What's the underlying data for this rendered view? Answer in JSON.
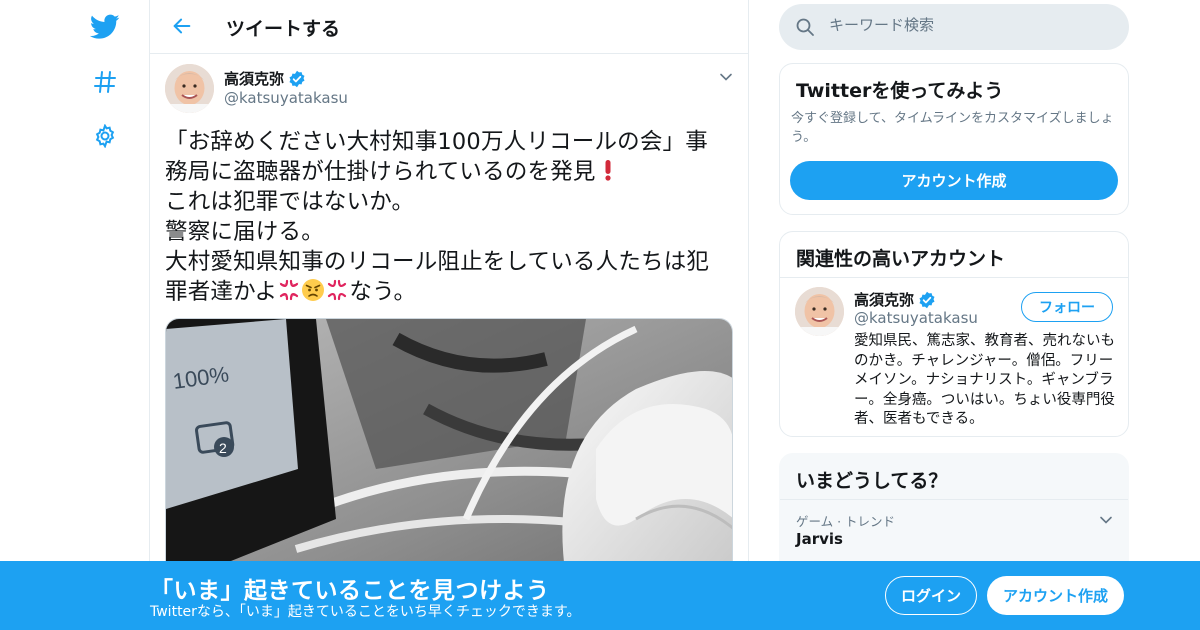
{
  "header": {
    "title": "ツイートする"
  },
  "tweet": {
    "author_name": "高須克弥",
    "author_handle": "@katsuyatakasu",
    "lines": [
      "「お辞めください大村知事100万人リコールの会」事",
      "務局に盗聴器が仕掛けられているのを発見",
      "これは犯罪ではないか。",
      "警察に届ける。",
      "大村愛知県知事のリコール阻止をしている人たちは犯",
      "罪者達かよ",
      "なう。"
    ]
  },
  "search": {
    "placeholder": "キーワード検索"
  },
  "signup_card": {
    "title": "Twitterを使ってみよう",
    "desc": "今すぐ登録して、タイムラインをカスタマイズしましょう。",
    "button": "アカウント作成"
  },
  "related_card": {
    "title": "関連性の高いアカウント",
    "name": "高須克弥",
    "handle": "@katsuyatakasu",
    "follow": "フォロー",
    "bio": "愛知県民、篤志家、教育者、売れないものかき。チャレンジャー。僧侶。フリーメイソン。ナショナリスト。ギャンブラー。全身癌。ついはい。ちょい役専門役者、医者もできる。"
  },
  "trends_card": {
    "title": "いまどうしてる？",
    "category": "ゲーム · トレンド",
    "name": "Jarvis"
  },
  "banner": {
    "title": "「いま」起きていることを見つけよう",
    "subtitle": "Twitterなら、「いま」起きていることをいち早くチェックできます。",
    "login": "ログイン",
    "signup": "アカウント作成"
  },
  "colors": {
    "accent": "#1da1f2",
    "text": "#14171a",
    "muted": "#657786",
    "border": "#e6ecf0"
  },
  "icons": [
    "twitter-bird-icon",
    "hashtag-icon",
    "settings-gear-icon",
    "back-arrow-icon",
    "verified-badge-icon",
    "chevron-down-icon",
    "search-icon",
    "red-exclamation-emoji",
    "anger-symbol-emoji",
    "angry-face-emoji"
  ]
}
